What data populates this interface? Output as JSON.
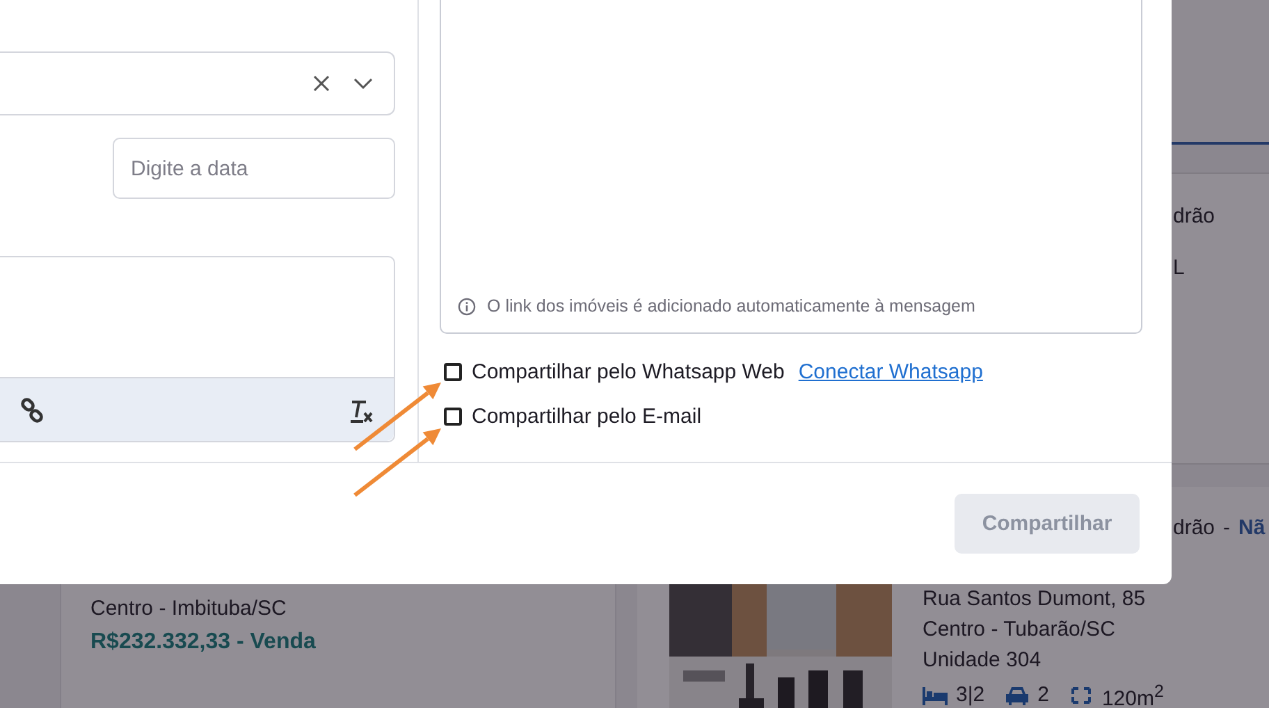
{
  "modal": {
    "date_field": {
      "placeholder": "Digite a data"
    },
    "message_note": "O link dos imóveis é adicionado automaticamente à mensagem",
    "share_options": [
      {
        "label": "Compartilhar pelo Whatsapp Web",
        "checked": false,
        "link": "Conectar Whatsapp"
      },
      {
        "label": "Compartilhar pelo E-mail",
        "checked": false
      }
    ],
    "share_button": {
      "label": "Compartilhar",
      "disabled": true
    }
  },
  "background": {
    "top_card": {
      "lines": [
        "drão",
        "L"
      ]
    },
    "left_card": {
      "location": "Centro - Imbituba/SC",
      "price": "R$232.332,33 - Venda"
    },
    "right_card": {
      "title": "drão",
      "title_separator": "-",
      "title_link": "Nã",
      "address": "Rua Santos Dumont, 85",
      "location": "Centro - Tubarão/SC",
      "unit": "Unidade 304",
      "rooms": "3|2",
      "parking": "2",
      "area": "120m$^{2}$"
    }
  }
}
